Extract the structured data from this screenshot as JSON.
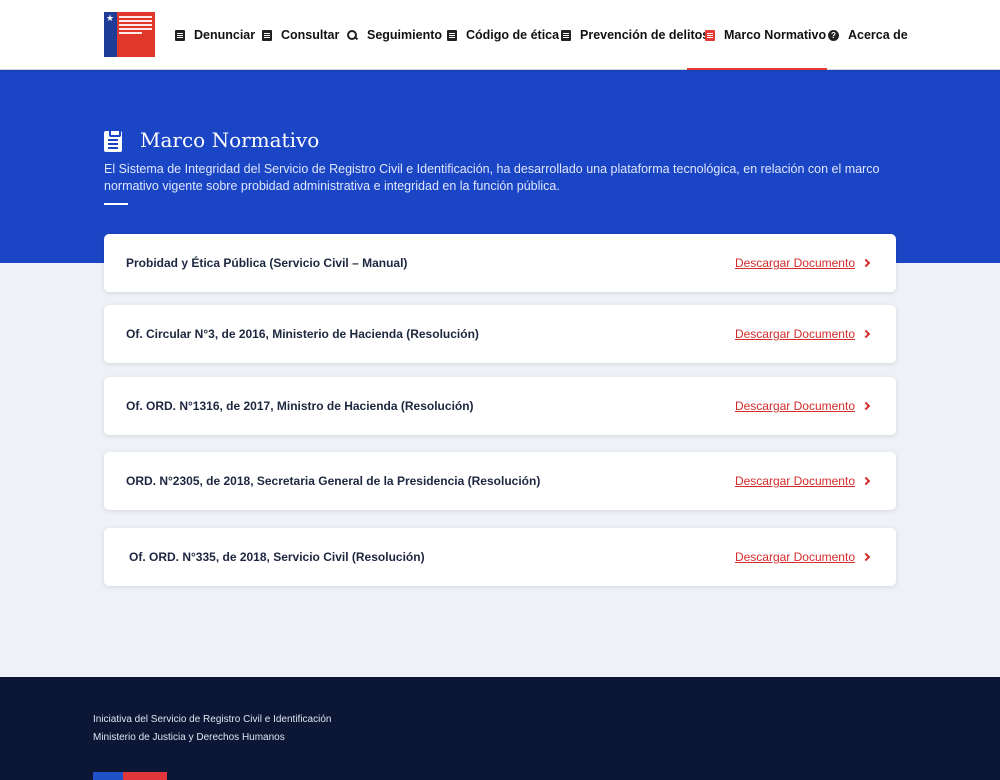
{
  "nav": {
    "items": [
      {
        "label": "Denunciar",
        "icon": "list-icon"
      },
      {
        "label": "Consultar",
        "icon": "list-icon"
      },
      {
        "label": "Seguimiento",
        "icon": "search-icon"
      },
      {
        "label": "Código de ética",
        "icon": "book-icon"
      },
      {
        "label": "Prevención de delitos",
        "icon": "book-icon"
      },
      {
        "label": "Marco Normativo",
        "icon": "clipboard-icon"
      },
      {
        "label": "Acerca de",
        "icon": "help-icon"
      }
    ],
    "active_index": 5
  },
  "hero": {
    "title": "Marco Normativo",
    "description": "El Sistema de Integridad del Servicio de Registro Civil e Identificación, ha desarrollado una plataforma tecnológica, en relación con el marco normativo vigente sobre probidad administrativa e integridad en la función pública."
  },
  "documents": [
    {
      "title": "Probidad y Ética Pública (Servicio Civil – Manual)",
      "link": "Descargar Documento"
    },
    {
      "title": "Of. Circular N°3, de 2016, Ministerio de Hacienda (Resolución)",
      "link": "Descargar Documento"
    },
    {
      "title": "Of. ORD. N°1316, de 2017, Ministro de Hacienda (Resolución)",
      "link": "Descargar Documento"
    },
    {
      "title": "ORD. N°2305, de 2018, Secretaria General de la Presidencia (Resolución)",
      "link": "Descargar Documento"
    },
    {
      "title": "Of. ORD. N°335, de 2018, Servicio Civil (Resolución)",
      "link": "Descargar Documento"
    }
  ],
  "footer": {
    "line1": "Iniciativa del Servicio de Registro Civil e Identificación",
    "line2": "Ministerio de Justicia y Derechos Humanos"
  },
  "colors": {
    "hero_blue": "#1a45c4",
    "accent_red": "#d62b2b",
    "footer_navy": "#0c1736",
    "page_bg": "#eef1f6"
  }
}
